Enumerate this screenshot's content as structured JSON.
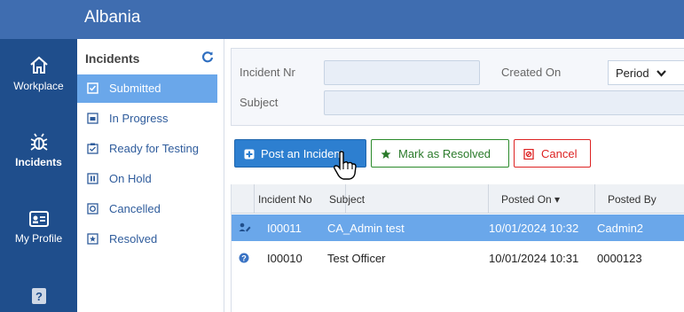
{
  "header": {
    "title": "Albania"
  },
  "nav": {
    "workplace": "Workplace",
    "incidents": "Incidents",
    "my_profile": "My Profile"
  },
  "status_panel": {
    "title": "Incidents",
    "items": [
      {
        "label": "Submitted",
        "active": true
      },
      {
        "label": "In Progress",
        "active": false
      },
      {
        "label": "Ready for Testing",
        "active": false
      },
      {
        "label": "On Hold",
        "active": false
      },
      {
        "label": "Cancelled",
        "active": false
      },
      {
        "label": "Resolved",
        "active": false
      }
    ]
  },
  "filter": {
    "incident_nr_label": "Incident Nr",
    "incident_nr_value": "",
    "created_on_label": "Created On",
    "created_on_value": "Period",
    "subject_label": "Subject",
    "subject_value": ""
  },
  "actions": {
    "post": "Post an Incident",
    "resolve": "Mark as Resolved",
    "cancel": "Cancel"
  },
  "grid": {
    "columns": [
      "Incident No",
      "Subject",
      "Posted On ▾",
      "Posted By"
    ],
    "rows": [
      {
        "icon": "user-edit-icon",
        "no": "I00011",
        "subject": "CA_Admin test",
        "posted_on": "10/01/2024 10:32",
        "posted_by": "Cadmin2",
        "selected": true
      },
      {
        "icon": "info-icon",
        "no": "I00010",
        "subject": "Test Officer",
        "posted_on": "10/01/2024 10:31",
        "posted_by": "0000123",
        "selected": false
      }
    ]
  },
  "colors": {
    "rail": "#1f4e8c",
    "header": "#3f6db0",
    "selection": "#6aa7ea",
    "post_button": "#2d7fd0",
    "resolve_green": "#2a8a2a",
    "cancel_red": "#dd2222"
  }
}
